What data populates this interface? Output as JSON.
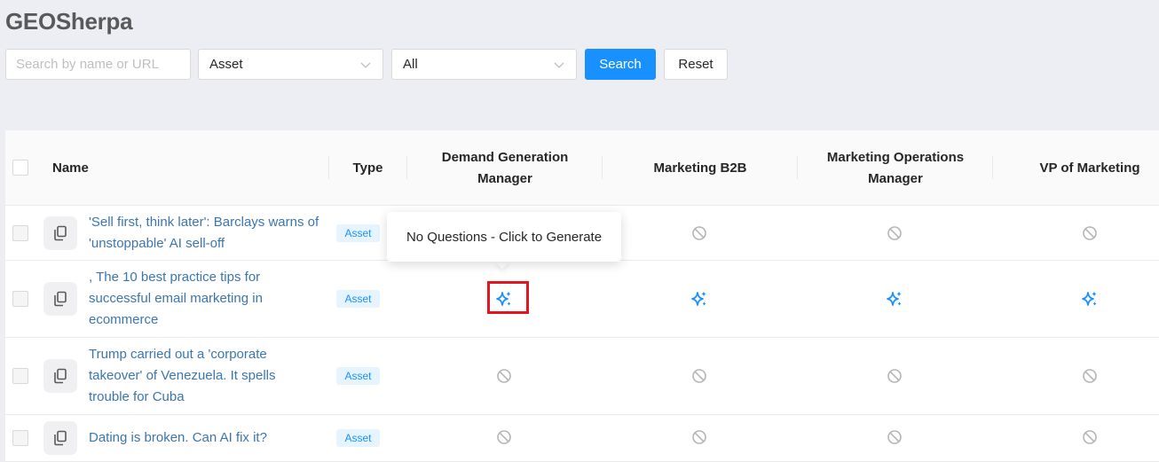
{
  "app": {
    "title": "GEOSherpa"
  },
  "filters": {
    "search_placeholder": "Search by name or URL",
    "type_select": "Asset",
    "status_select": "All",
    "search_button": "Search",
    "reset_button": "Reset"
  },
  "table": {
    "columns": {
      "name": "Name",
      "type": "Type",
      "demand_gen": "Demand Generation Manager",
      "marketing_b2b": "Marketing B2B",
      "marketing_ops": "Marketing Operations Manager",
      "vp_marketing": "VP of Marketing"
    },
    "rows": [
      {
        "name": "'Sell first, think later': Barclays warns of 'unstoppable' AI sell-off",
        "type": "Asset",
        "cells": [
          "hidden",
          "no-questions-icon",
          "no-questions-icon",
          "no-questions-icon"
        ]
      },
      {
        "name": ", The 10 best practice tips for successful email marketing in ecommerce",
        "type": "Asset",
        "cells": [
          "generate-sparkle-icon",
          "generate-sparkle-icon",
          "generate-sparkle-icon",
          "generate-sparkle-icon"
        ]
      },
      {
        "name": "Trump carried out a 'corporate takeover' of Venezuela. It spells trouble for Cuba",
        "type": "Asset",
        "cells": [
          "no-questions-icon",
          "no-questions-icon",
          "no-questions-icon",
          "no-questions-icon"
        ]
      },
      {
        "name": "Dating is broken. Can AI fix it?",
        "type": "Asset",
        "cells": [
          "no-questions-icon",
          "no-questions-icon",
          "no-questions-icon",
          "no-questions-icon"
        ]
      }
    ]
  },
  "tooltip": {
    "text": "No Questions - Click to Generate"
  },
  "colors": {
    "primary": "#1890ff",
    "link": "#3a76b0",
    "highlight": "#e5141f",
    "muted_icon": "#b5b5b5"
  }
}
